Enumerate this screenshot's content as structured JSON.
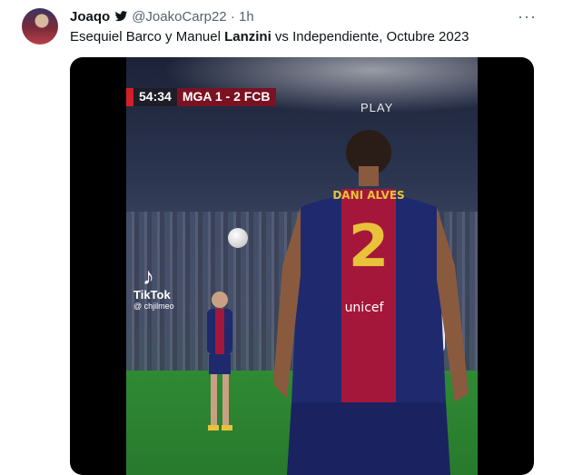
{
  "tweet": {
    "display_name": "Joaqo",
    "handle": "@JoakoCarp22",
    "separator": "·",
    "time": "1h",
    "more": "···",
    "text_before": "Esequiel Barco y Manuel ",
    "text_bold": "Lanzini",
    "text_after": " vs Independiente, Octubre 2023"
  },
  "video": {
    "clock": "54:34",
    "scoreline": "MGA 1 - 2 FCB",
    "overlay": "PLAY",
    "jersey_name": "DANI ALVES",
    "jersey_number": "2",
    "sponsor": "unicef",
    "watermark_brand": "TikTok",
    "watermark_user": "@ chjilmeo"
  },
  "colors": {
    "name": "#0f1419",
    "meta": "#536471",
    "barca_blue": "#1f2a6e",
    "barca_red": "#a5173a"
  }
}
